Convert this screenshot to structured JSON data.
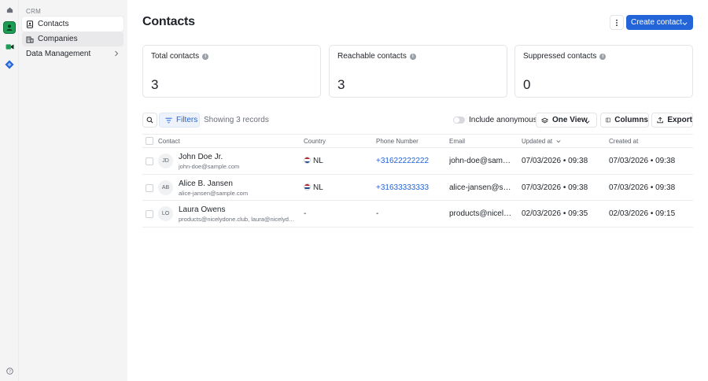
{
  "sidebar": {
    "section": "CRM",
    "items": [
      {
        "label": "Contacts"
      },
      {
        "label": "Companies"
      },
      {
        "label": "Data Management"
      }
    ]
  },
  "header": {
    "title": "Contacts",
    "create_label": "Create contact"
  },
  "stats": [
    {
      "label": "Total contacts",
      "value": "3"
    },
    {
      "label": "Reachable contacts",
      "value": "3"
    },
    {
      "label": "Suppressed contacts",
      "value": "0"
    }
  ],
  "toolbar": {
    "filters_label": "Filters",
    "showing": "Showing 3 records",
    "include_anonymous": "Include anonymous",
    "view_label": "One View",
    "columns_label": "Columns",
    "export_label": "Export"
  },
  "table": {
    "columns": [
      "Contact",
      "Country",
      "Phone Number",
      "Email",
      "Updated at",
      "Created at"
    ],
    "rows": [
      {
        "initials": "JD",
        "name": "John Doe Jr.",
        "email_sub": "john-doe@sample.com",
        "country": "NL",
        "phone": "+31622222222",
        "email": "john-doe@sample.com",
        "updated": "07/03/2026 • 09:38",
        "created": "07/03/2026 • 09:38"
      },
      {
        "initials": "AB",
        "name": "Alice B. Jansen",
        "email_sub": "alice-jansen@sample.com",
        "country": "NL",
        "phone": "+31633333333",
        "email": "alice-jansen@sample.com",
        "updated": "07/03/2026 • 09:38",
        "created": "07/03/2026 • 09:38"
      },
      {
        "initials": "LO",
        "name": "Laura Owens",
        "email_sub": "products@nicelydone.club, laura@nicelydone.club",
        "country": "-",
        "phone": "-",
        "email": "products@nicelydone.club",
        "updated": "02/03/2026 • 09:35",
        "created": "02/03/2026 • 09:15"
      }
    ]
  },
  "colors": {
    "accent": "#2364d8",
    "rail_active": "#1f9d55",
    "sidebar_bg": "#f4f4f5"
  }
}
